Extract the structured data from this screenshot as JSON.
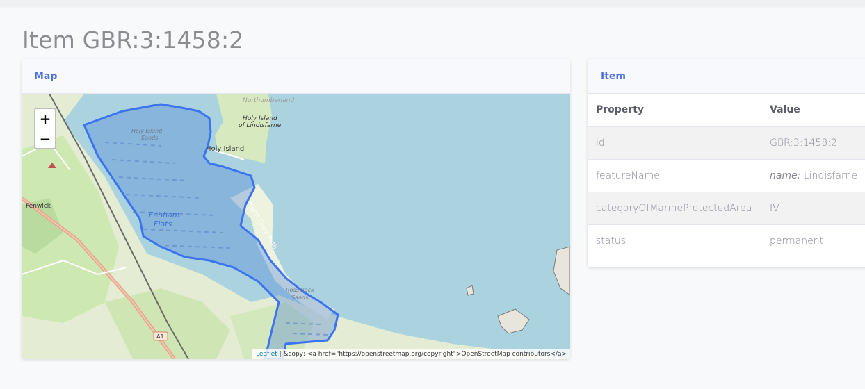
{
  "page": {
    "title": "Item GBR:3:1458:2"
  },
  "map_card": {
    "header": "Map",
    "zoom_in": "+",
    "zoom_out": "−",
    "attribution_leaflet": "Leaflet",
    "attribution_rest": " | &copy; <a href=\"https://openstreetmap.org/copyright\">OpenStreetMap contributors</a>",
    "labels": {
      "northumberland": "Northumberland",
      "holy_island_title": "Holy Island",
      "of_lindisfarne": "of Lindisfarne",
      "holy_island_sands": "Holy Island",
      "sands": "Sands",
      "holy_island_village": "Holy Island",
      "fenwick": "Fenwick",
      "fenham": "Fenham",
      "flats": "Flats",
      "coast_path": "North Coast Path",
      "ross_back": "Ross Back",
      "ross_sands": "Sands",
      "road_a1": "A1"
    },
    "colors": {
      "sea": "#aad3df",
      "land": "#f2efe9",
      "fields": "#cde8b1",
      "protected_fill": "#4a7fd8",
      "protected_stroke": "#3b73f0"
    }
  },
  "item_card": {
    "header": "Item",
    "columns": [
      "Property",
      "Value"
    ],
    "rows": [
      {
        "property": "id",
        "value_prefix": "",
        "value": "GBR:3:1458:2"
      },
      {
        "property": "featureName",
        "value_prefix": "name:",
        "value": " Lindisfarne"
      },
      {
        "property": "categoryOfMarineProtectedArea",
        "value_prefix": "",
        "value": "IV"
      },
      {
        "property": "status",
        "value_prefix": "",
        "value": "permanent"
      }
    ]
  }
}
